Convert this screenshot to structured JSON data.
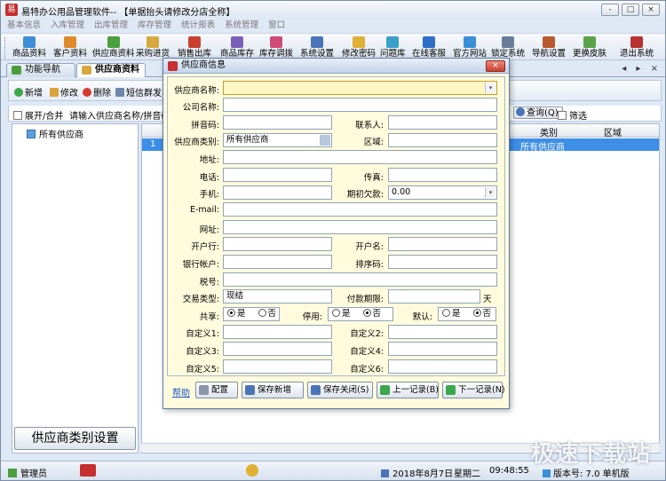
{
  "window": {
    "title": "易特办公用品管理软件-- 【单据抬头请修改分店全称】",
    "controls": [
      "-",
      "□",
      "×"
    ]
  },
  "menu": [
    "基本信息",
    "入库管理",
    "出库管理",
    "库存管理",
    "统计报表",
    "系统管理",
    "窗口"
  ],
  "toolbar": [
    {
      "label": "商品资料",
      "color": "#3f8fd6"
    },
    {
      "label": "客户资料",
      "color": "#e08a2c"
    },
    {
      "label": "供应商资料",
      "color": "#4a9e3c"
    },
    {
      "label": "采购进货",
      "color": "#d6a93f"
    },
    {
      "label": "销售出库",
      "color": "#c9402f"
    },
    {
      "label": "商品库存",
      "color": "#7b5fb8"
    },
    {
      "label": "库存调拨",
      "color": "#d24a77"
    },
    {
      "label": "系统设置",
      "color": "#4b74b8"
    },
    {
      "label": "修改密码",
      "color": "#e0b035"
    },
    {
      "label": "问题库",
      "color": "#3aa0c8"
    },
    {
      "label": "在线客服",
      "color": "#2d6fc9"
    },
    {
      "label": "官方网站",
      "color": "#3a8fd8"
    },
    {
      "label": "锁定系统",
      "color": "#6a7e99"
    },
    {
      "label": "导航设置",
      "color": "#b85a2e"
    },
    {
      "label": "更换皮肤",
      "color": "#5aa34a"
    },
    {
      "label": "退出系统",
      "color": "#b83232"
    }
  ],
  "tabs": [
    {
      "label": "功能导航",
      "active": false
    },
    {
      "label": "供应商资料",
      "active": true
    }
  ],
  "tab_controls": "◂ ▸ ×",
  "sub_toolbar": {
    "new": "新增",
    "edit": "修改",
    "delete": "删除",
    "sms": "短信群发",
    "query": "查询(Q)",
    "filter": "筛选"
  },
  "filter_row": {
    "expand": "展开/合并",
    "search_hint": "请输入供应商名称/拼音码/公"
  },
  "tree": {
    "root": "所有供应商"
  },
  "category_button": "供应商类别设置",
  "grid": {
    "headers": [
      "类别",
      "区域"
    ],
    "rows": [
      {
        "index": "1",
        "category": "所有供应商",
        "region": ""
      }
    ]
  },
  "dialog": {
    "title": "供应商信息",
    "close": "×",
    "fields": {
      "supplier_name": {
        "label": "供应商名称:",
        "value": ""
      },
      "company_name": {
        "label": "公司名称:",
        "value": ""
      },
      "pinyin": {
        "label": "拼音码:",
        "value": ""
      },
      "contact": {
        "label": "联系人:",
        "value": ""
      },
      "supplier_category": {
        "label": "供应商类别:",
        "value": "所有供应商"
      },
      "region": {
        "label": "区域:",
        "value": ""
      },
      "address": {
        "label": "地址:",
        "value": ""
      },
      "phone": {
        "label": "电话:",
        "value": ""
      },
      "fax": {
        "label": "传真:",
        "value": ""
      },
      "mobile": {
        "label": "手机:",
        "value": ""
      },
      "initial_debt": {
        "label": "期初欠款:",
        "value": "0.00"
      },
      "email": {
        "label": "E-mail:",
        "value": ""
      },
      "website": {
        "label": "网址:",
        "value": ""
      },
      "bank": {
        "label": "开户行:",
        "value": ""
      },
      "account_name": {
        "label": "开户名:",
        "value": ""
      },
      "bank_account": {
        "label": "银行帐户:",
        "value": ""
      },
      "sort_code": {
        "label": "排序码:",
        "value": ""
      },
      "tax_no": {
        "label": "税号:",
        "value": ""
      },
      "trade_type": {
        "label": "交易类型:",
        "value": "现结"
      },
      "payment_term": {
        "label": "付款期限:",
        "value": "",
        "suffix": "天"
      },
      "custom1": {
        "label": "自定义1:",
        "value": ""
      },
      "custom2": {
        "label": "自定义2:",
        "value": ""
      },
      "custom3": {
        "label": "自定义3:",
        "value": ""
      },
      "custom4": {
        "label": "自定义4:",
        "value": ""
      },
      "custom5": {
        "label": "自定义5:",
        "value": ""
      },
      "custom6": {
        "label": "自定义6:",
        "value": ""
      }
    },
    "radios": {
      "share": {
        "label": "共享:",
        "yes": "是",
        "no": "否",
        "selected": "yes"
      },
      "disable": {
        "label": "停用:",
        "yes": "是",
        "no": "否",
        "selected": "no"
      },
      "default": {
        "label": "默认:",
        "yes": "是",
        "no": "否",
        "selected": "no"
      }
    },
    "footer": {
      "help": "帮助",
      "config": "配置",
      "save_new": "保存新增",
      "save_close": "保存关闭(S)",
      "prev": "上一记录(B)",
      "next": "下一记录(N)"
    }
  },
  "statusbar": {
    "user": "管理员",
    "date": "2018年8月7日",
    "weekday": "星期二",
    "time": "09:48:55",
    "version": "版本号: 7.0 单机版"
  },
  "watermark": "极速下载站"
}
